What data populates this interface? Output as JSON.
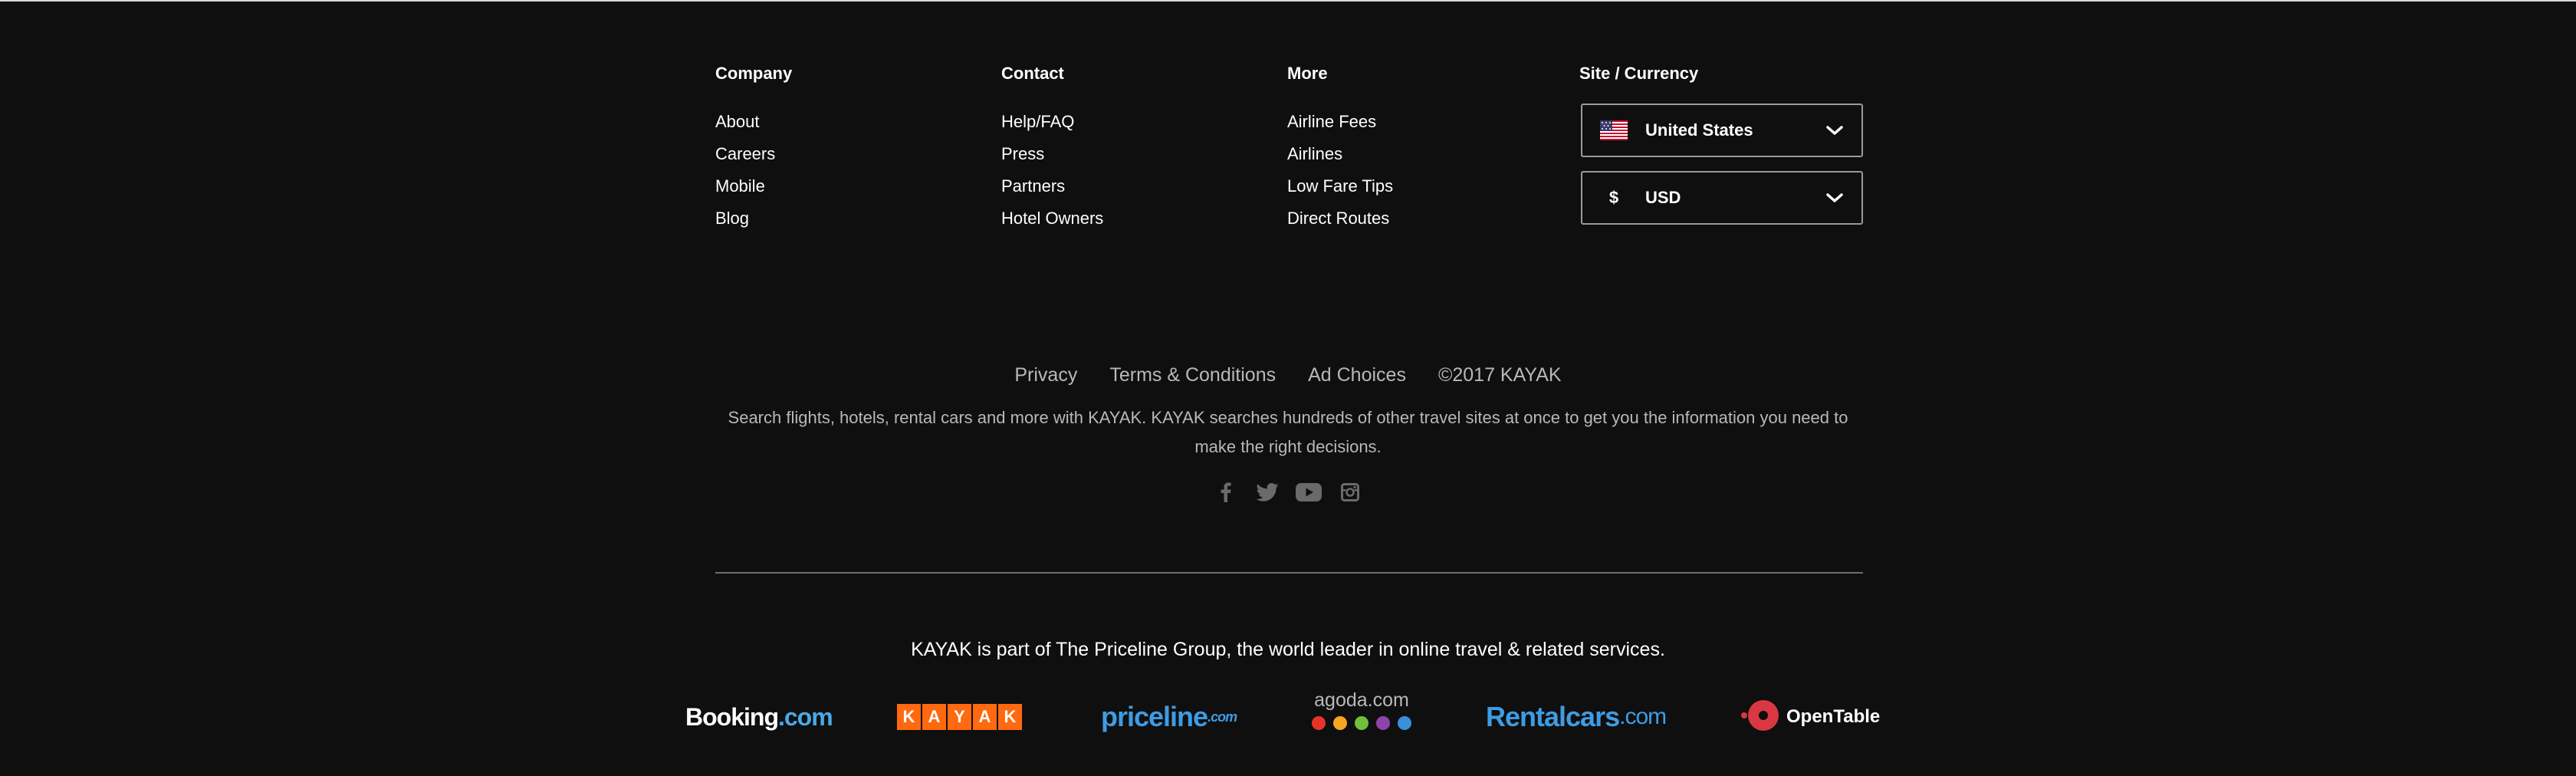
{
  "columns": [
    {
      "title": "Company",
      "links": [
        "About",
        "Careers",
        "Mobile",
        "Blog"
      ]
    },
    {
      "title": "Contact",
      "links": [
        "Help/FAQ",
        "Press",
        "Partners",
        "Hotel Owners"
      ]
    },
    {
      "title": "More",
      "links": [
        "Airline Fees",
        "Airlines",
        "Low Fare Tips",
        "Direct Routes"
      ]
    }
  ],
  "site_currency": {
    "title": "Site / Currency",
    "site_value": "United States",
    "site_icon": "us-flag-icon",
    "currency_symbol": "$",
    "currency_value": "USD",
    "chevron_icon": "chevron-down-icon"
  },
  "legal": {
    "privacy": "Privacy",
    "terms": "Terms & Conditions",
    "ad_choices": "Ad Choices",
    "copyright": "©2017 KAYAK"
  },
  "description": "Search flights, hotels, rental cars and more with KAYAK. KAYAK searches hundreds of other travel sites at once to get you the information you need to make the right decisions.",
  "social_icons": [
    "facebook-icon",
    "twitter-icon",
    "youtube-icon",
    "instagram-icon"
  ],
  "priceline_note": "KAYAK is part of The Priceline Group, the world leader in online travel & related services.",
  "brands": {
    "booking": {
      "name": "Booking",
      "suffix": ".com"
    },
    "kayak": {
      "letters": [
        "K",
        "A",
        "Y",
        "A",
        "K"
      ]
    },
    "priceline": {
      "name": "priceline",
      "suffix": ".com"
    },
    "agoda": {
      "name": "agoda.com"
    },
    "rentalcars": {
      "name": "Rentalcars",
      "suffix": ".com"
    },
    "opentable": {
      "name": "OpenTable"
    }
  },
  "colors": {
    "background": "#0f0f0f",
    "kayak_orange": "#ff690f",
    "priceline_blue": "#3e9ce4",
    "opentable_red": "#da3743",
    "agoda_dots": [
      "#e8332a",
      "#f5a623",
      "#6fbf3b",
      "#8e44ad",
      "#3b8fd9"
    ]
  }
}
